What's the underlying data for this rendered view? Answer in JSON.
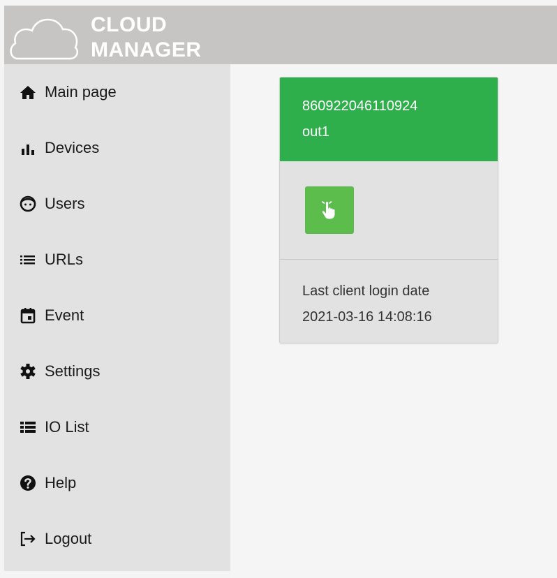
{
  "brand": {
    "line1": "CLOUD",
    "line2": "MANAGER"
  },
  "sidebar": {
    "items": [
      {
        "label": "Main page",
        "icon": "home-icon"
      },
      {
        "label": "Devices",
        "icon": "bar-chart-icon"
      },
      {
        "label": "Users",
        "icon": "user-face-icon"
      },
      {
        "label": "URLs",
        "icon": "list-icon"
      },
      {
        "label": "Event",
        "icon": "calendar-icon"
      },
      {
        "label": "Settings",
        "icon": "gear-icon"
      },
      {
        "label": "IO List",
        "icon": "io-list-icon"
      },
      {
        "label": "Help",
        "icon": "help-icon"
      },
      {
        "label": "Logout",
        "icon": "logout-icon"
      }
    ]
  },
  "device_card": {
    "device_id": "860922046110924",
    "output_name": "out1",
    "action_icon": "hand-pointer-icon",
    "login_label": "Last client login date",
    "login_date": "2021-03-16 14:08:16"
  },
  "colors": {
    "header_bg": "#c7c5c4",
    "sidebar_bg": "#e2e2e2",
    "card_header_bg": "#2eaf4c",
    "action_button_bg": "#5cbd4d"
  }
}
